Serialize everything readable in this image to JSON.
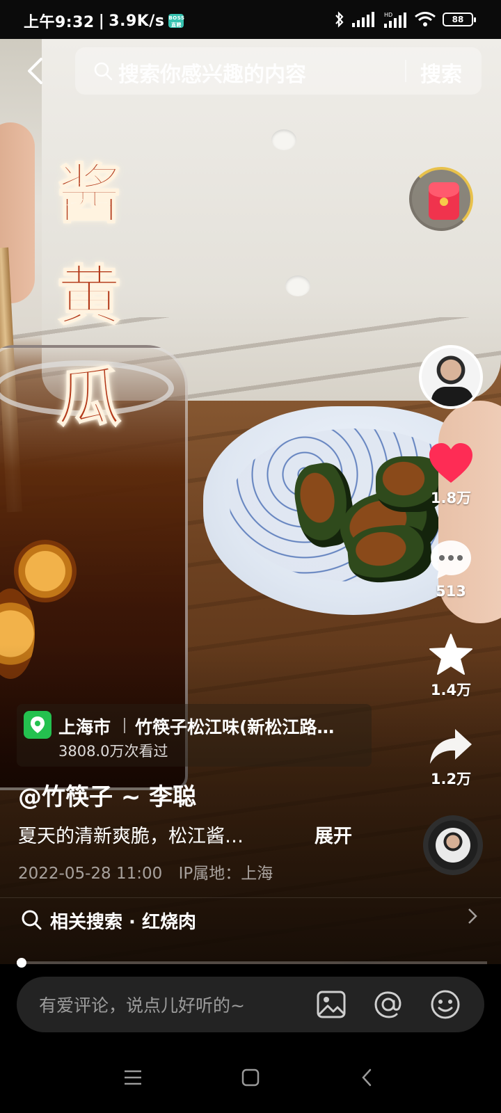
{
  "status_bar": {
    "time": "上午9:32",
    "speed": "3.9K/s",
    "app_badge": "BOSS直聘",
    "battery": "88",
    "signal_label": "HD"
  },
  "search": {
    "placeholder": "搜索你感兴趣的内容",
    "button_label": "搜索"
  },
  "video": {
    "overlay_title": [
      "酱",
      "黄",
      "瓜"
    ]
  },
  "actions": {
    "likes": "1.8万",
    "comments": "513",
    "favorites": "1.4万",
    "shares": "1.2万",
    "like_color": "#fe2c55"
  },
  "location": {
    "city": "上海市",
    "place": "竹筷子松江味(新松江路…",
    "views": "3808.0万次看过"
  },
  "post": {
    "author": "@竹筷子 ~ 李聪",
    "description": "夏天的清新爽脆，松江酱…",
    "expand_label": "展开",
    "datetime": "2022-05-28 11:00",
    "ip": "IP属地：上海"
  },
  "related": {
    "text": "相关搜索 · 红烧肉"
  },
  "progress": {
    "fraction": 0.01
  },
  "comment": {
    "placeholder": "有爱评论，说点儿好听的~"
  },
  "icons": {
    "back": "back-arrow-icon",
    "search": "search-icon",
    "like": "heart-icon",
    "comment": "comment-bubble-icon",
    "favorite": "star-icon",
    "share": "share-arrow-icon",
    "image": "image-icon",
    "mention": "at-icon",
    "emoji": "emoji-icon"
  }
}
